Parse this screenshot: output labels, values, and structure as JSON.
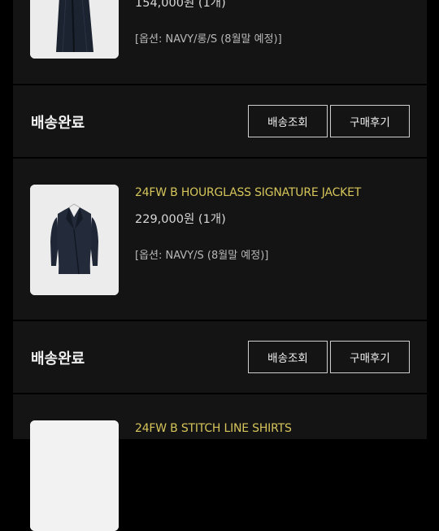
{
  "orders": [
    {
      "product_name": "",
      "price": "154,000원 (1개)",
      "option": "[옵션: NAVY/롱/S (8월말 예정)]",
      "image": "navy-long-skirt"
    },
    {
      "product_name": "24FW B HOURGLASS SIGNATURE JACKET",
      "price": "229,000원 (1개)",
      "option": "[옵션: NAVY/S (8월말 예정)]",
      "image": "navy-jacket"
    },
    {
      "product_name": "24FW B STITCH LINE SHIRTS",
      "image": "shirt"
    }
  ],
  "status_rows": [
    {
      "status": "배송완료",
      "track_label": "배송조회",
      "review_label": "구매후기"
    },
    {
      "status": "배송완료",
      "track_label": "배송조회",
      "review_label": "구매후기"
    }
  ],
  "colors": {
    "page_bg": "#000000",
    "card_bg": "#141414",
    "product_name": "#d6c55a",
    "button_border": "#cfcfcf"
  }
}
